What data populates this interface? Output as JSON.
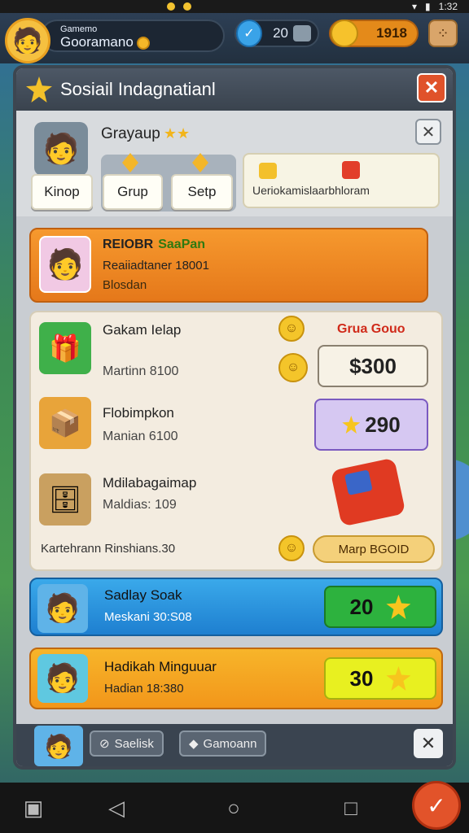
{
  "status_bar": {
    "time": "1:32"
  },
  "top_bar": {
    "player_small": "Gamemo",
    "player_name": "Gooramano",
    "energy": "20",
    "gold": "1918"
  },
  "panel": {
    "title": "Sosiail Indagnatianl",
    "sub": {
      "name": "Grayaup",
      "tabs": [
        "Kinop",
        "Grup",
        "Setp"
      ],
      "search_placeholder": "Ueriokamislaarbhloram"
    },
    "featured": {
      "title": "REIOBR",
      "badge": "SaaPan",
      "line1": "Reaiiadtaner 18001",
      "line2": "Blosdan"
    },
    "list": {
      "promo_title": "Grua Gouo",
      "items": [
        {
          "name": "Gakam Ielap",
          "sub": "Martinn 8100",
          "price": "$300"
        },
        {
          "name": "Flobimpkon",
          "sub": "Manian 6100",
          "price": "290"
        },
        {
          "name": "Mdilabagaimap",
          "sub": "Maldias: 109"
        }
      ],
      "footer": "Kartehrann Rinshians.30",
      "map_button": "Marp BGOID"
    },
    "daily": {
      "name": "Sadlay Soak",
      "time": "Meskani 30:S08",
      "value": "20"
    },
    "weekly": {
      "name": "Hadikah Minguuar",
      "time": "Hadian 18:380",
      "value": "30"
    },
    "footer": {
      "tab1": "Saelisk",
      "tab2": "Gamoann"
    }
  },
  "colors": {
    "accent_orange": "#f29a2e",
    "gold": "#f4b829",
    "blue": "#1e7fd0",
    "green": "#2db23e"
  }
}
